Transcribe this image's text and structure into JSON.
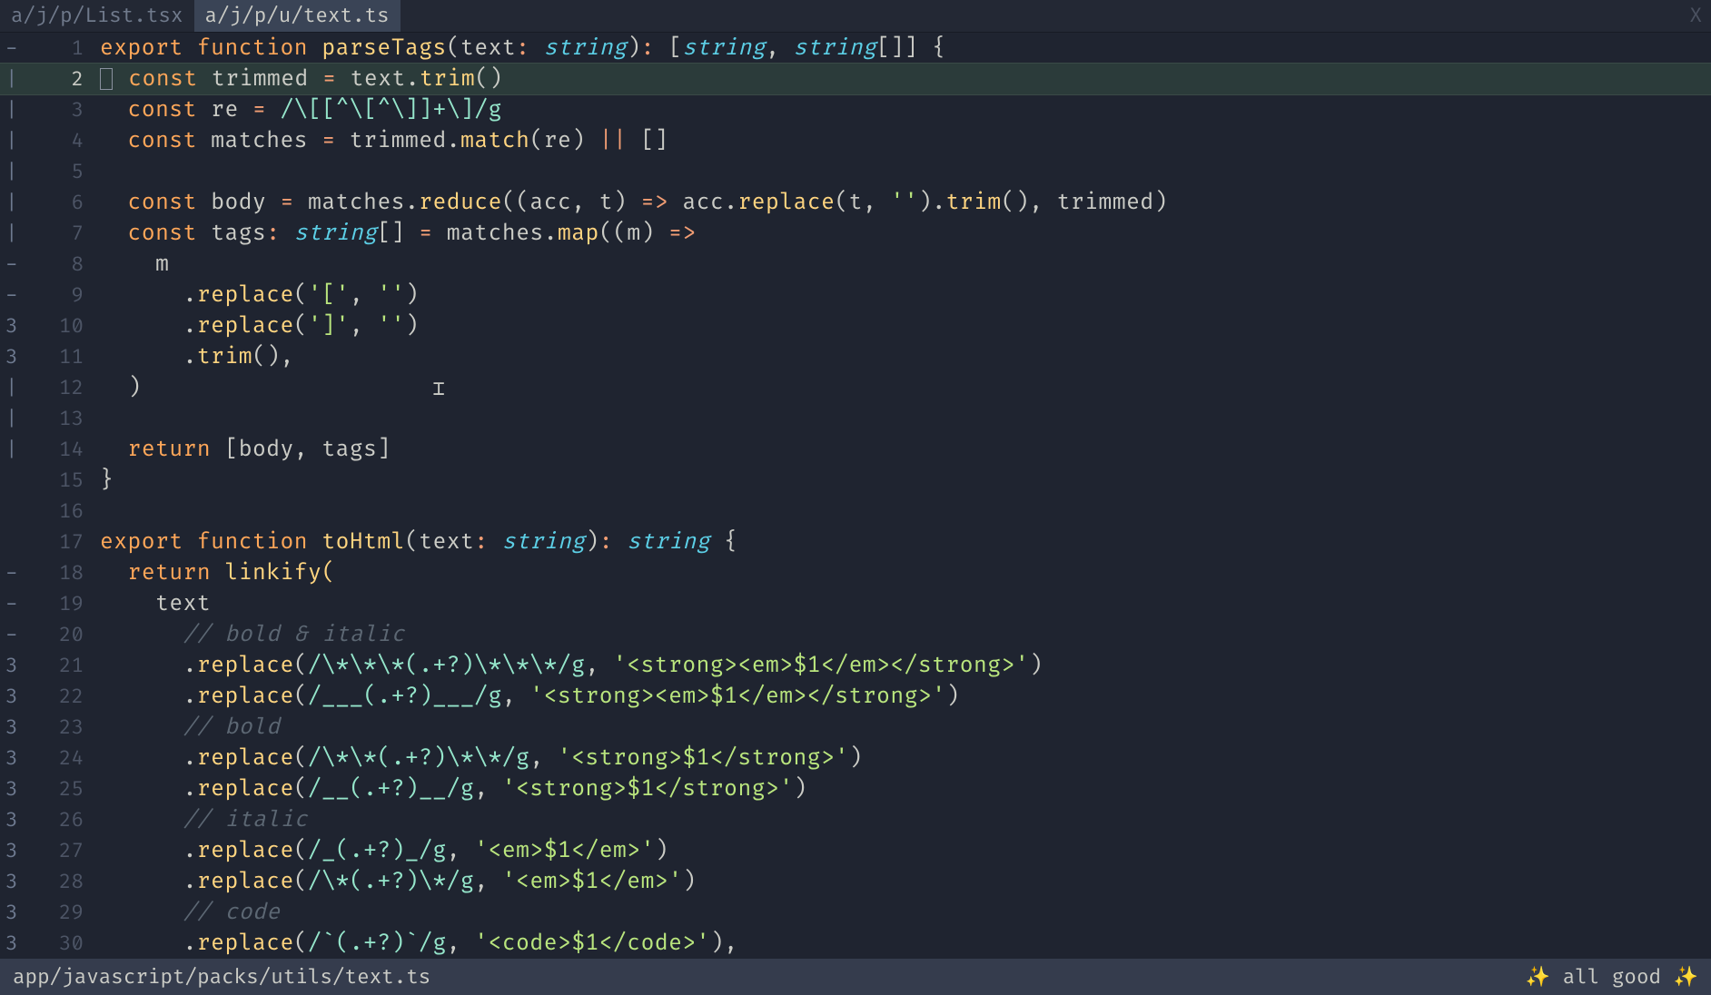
{
  "tabs": {
    "inactive": "a/j/p/List.tsx",
    "active": "a/j/p/u/text.ts",
    "close": "X"
  },
  "status": {
    "path": "app/javascript/packs/utils/text.ts",
    "ok": "all good",
    "sparkle": "✨"
  },
  "gutter": [
    "-",
    "|",
    "|",
    "|",
    "|",
    "|",
    "|",
    "-",
    "-",
    "3",
    "3",
    "|",
    "|",
    "|",
    "",
    "",
    "",
    "-",
    "-",
    "-",
    "3",
    "3",
    "3",
    "3",
    "3",
    "3",
    "3",
    "3",
    "3",
    "3"
  ],
  "code": {
    "l1": {
      "a": "export",
      "b": "function",
      "c": "parseTags",
      "d": "(text",
      "e": ":",
      "f": "string",
      "g": ")",
      "h": ":",
      "i": "[",
      "j": "string",
      "k": ",",
      "l": "string",
      "m": "[]]",
      "n": "{"
    },
    "l2": {
      "a": "const",
      "b": "trimmed",
      "c": "=",
      "d": "text.",
      "e": "trim",
      "f": "()"
    },
    "l3": {
      "a": "const",
      "b": "re",
      "c": "=",
      "d": "/\\[[^\\[^\\]]+\\]/g"
    },
    "l4": {
      "a": "const",
      "b": "matches",
      "c": "=",
      "d": "trimmed.",
      "e": "match",
      "f": "(re)",
      "g": "||",
      "h": "[]"
    },
    "l6": {
      "a": "const",
      "b": "body",
      "c": "=",
      "d": "matches.",
      "e": "reduce",
      "f": "((acc, t)",
      "g": "=>",
      "h": "acc.",
      "i": "replace",
      "j": "(t,",
      "k": "''",
      "l": ").",
      "m": "trim",
      "n": "(), trimmed)"
    },
    "l7": {
      "a": "const",
      "b": "tags",
      "c": ":",
      "d": "string",
      "e": "[]",
      "f": "=",
      "g": "matches.",
      "h": "map",
      "i": "((m)",
      "j": "=>"
    },
    "l8": {
      "a": "m"
    },
    "l9": {
      "a": ".",
      "b": "replace",
      "c": "(",
      "d": "'['",
      "e": ",",
      "f": "''",
      "g": ")"
    },
    "l10": {
      "a": ".",
      "b": "replace",
      "c": "(",
      "d": "']'",
      "e": ",",
      "f": "''",
      "g": ")"
    },
    "l11": {
      "a": ".",
      "b": "trim",
      "c": "(),"
    },
    "l12": {
      "a": ")"
    },
    "l14": {
      "a": "return",
      "b": "[body, tags]"
    },
    "l15": {
      "a": "}"
    },
    "l17": {
      "a": "export",
      "b": "function",
      "c": "toHtml",
      "d": "(text",
      "e": ":",
      "f": "string",
      "g": ")",
      "h": ":",
      "i": "string",
      "j": "{"
    },
    "l18": {
      "a": "return",
      "b": "linkify("
    },
    "l19": {
      "a": "text"
    },
    "l20": {
      "a": "// bold & italic"
    },
    "l21": {
      "a": ".",
      "b": "replace",
      "c": "(",
      "d": "/\\*\\*\\*(.+?)\\*\\*\\*/g",
      "e": ",",
      "f": "'<strong><em>$1</em></strong>'",
      "g": ")"
    },
    "l22": {
      "a": ".",
      "b": "replace",
      "c": "(",
      "d": "/___(.+?)___/g",
      "e": ",",
      "f": "'<strong><em>$1</em></strong>'",
      "g": ")"
    },
    "l23": {
      "a": "// bold"
    },
    "l24": {
      "a": ".",
      "b": "replace",
      "c": "(",
      "d": "/\\*\\*(.+?)\\*\\*/g",
      "e": ",",
      "f": "'<strong>$1</strong>'",
      "g": ")"
    },
    "l25": {
      "a": ".",
      "b": "replace",
      "c": "(",
      "d": "/__(.+?)__/g",
      "e": ",",
      "f": "'<strong>$1</strong>'",
      "g": ")"
    },
    "l26": {
      "a": "// italic"
    },
    "l27": {
      "a": ".",
      "b": "replace",
      "c": "(",
      "d": "/_(.+?)_/g",
      "e": ",",
      "f": "'<em>$1</em>'",
      "g": ")"
    },
    "l28": {
      "a": ".",
      "b": "replace",
      "c": "(",
      "d": "/\\*(.+?)\\*/g",
      "e": ",",
      "f": "'<em>$1</em>'",
      "g": ")"
    },
    "l29": {
      "a": "// code"
    },
    "l30": {
      "a": ".",
      "b": "replace",
      "c": "(",
      "d": "/`(.+?)`/g",
      "e": ",",
      "f": "'<code>$1</code>'",
      "g": "),"
    }
  }
}
